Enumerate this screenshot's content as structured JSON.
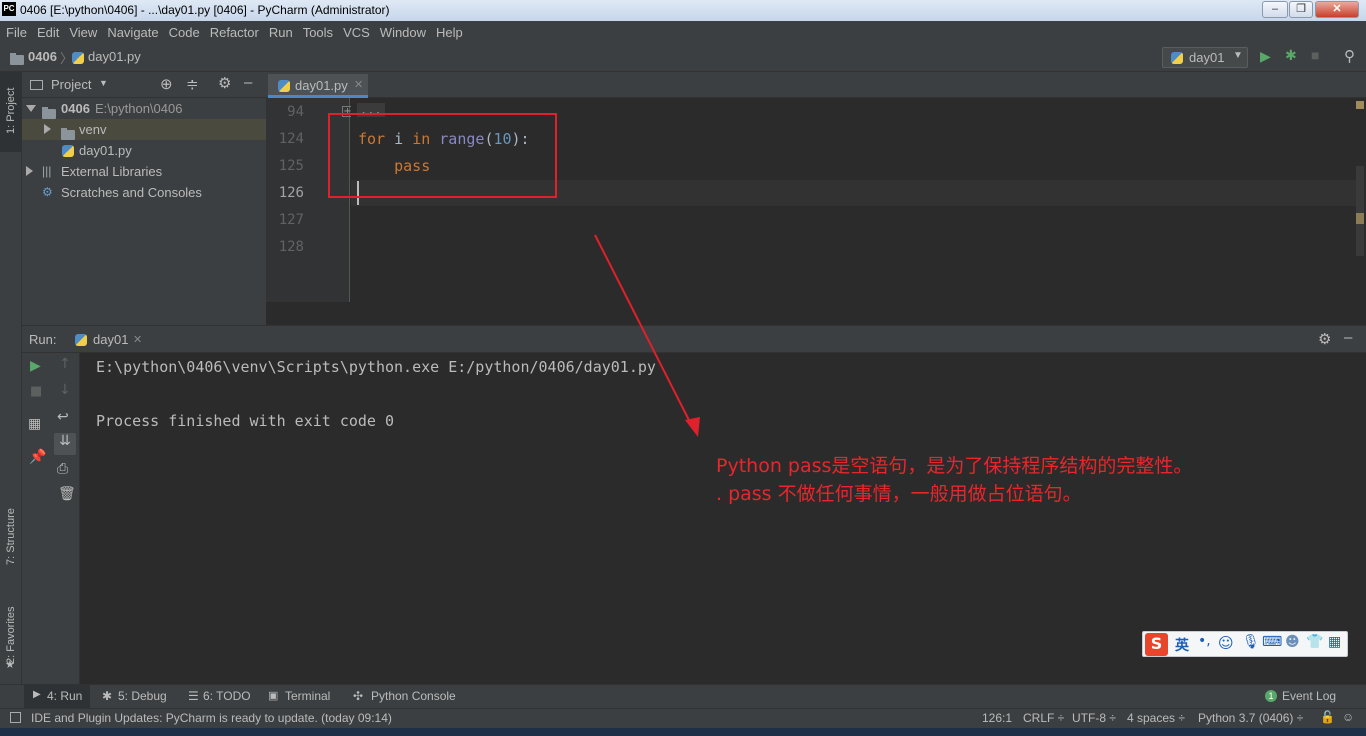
{
  "window": {
    "title": "0406 [E:\\python\\0406] - ...\\day01.py [0406] - PyCharm (Administrator)",
    "logo": "PC"
  },
  "menu": [
    "File",
    "Edit",
    "View",
    "Navigate",
    "Code",
    "Refactor",
    "Run",
    "Tools",
    "VCS",
    "Window",
    "Help"
  ],
  "navbar": {
    "project": "0406",
    "file": "day01.py",
    "run_config": "day01"
  },
  "left_strip": {
    "project": "1: Project",
    "structure": "7: Structure",
    "favorites": "2: Favorites"
  },
  "project_panel": {
    "title": "Project",
    "tree": [
      {
        "label": "0406",
        "path": "E:\\python\\0406"
      },
      {
        "label": "venv"
      },
      {
        "label": "day01.py"
      },
      {
        "label": "External Libraries"
      },
      {
        "label": "Scratches and Consoles"
      }
    ]
  },
  "editor": {
    "tab": "day01.py",
    "line_numbers": [
      "94",
      "124",
      "125",
      "126",
      "127",
      "128"
    ],
    "folded": "...",
    "code": {
      "l124": {
        "kw": "for",
        "var": " i ",
        "in": "in",
        "fn": "range",
        "open": "(",
        "num": "10",
        "close": "):"
      },
      "l125": {
        "indent": "    ",
        "kw": "pass"
      }
    }
  },
  "run_panel": {
    "label": "Run:",
    "tab": "day01",
    "console": [
      "E:\\python\\0406\\venv\\Scripts\\python.exe E:/python/0406/day01.py",
      "",
      "Process finished with exit code 0"
    ]
  },
  "annotation": {
    "line1": "Python pass是空语句，是为了保持程序结构的完整性。",
    "line2": ". pass 不做任何事情，一般用做占位语句。"
  },
  "ime": {
    "label": "英"
  },
  "tool_windows": {
    "run": "4: Run",
    "debug": "5: Debug",
    "todo": "6: TODO",
    "terminal": "Terminal",
    "python_console": "Python Console",
    "event_log": "Event Log",
    "event_count": "1"
  },
  "status": {
    "message": "IDE and Plugin Updates: PyCharm is ready to update. (today 09:14)",
    "position": "126:1",
    "line_sep": "CRLF ÷",
    "encoding": "UTF-8 ÷",
    "indent": "4 spaces ÷",
    "interpreter": "Python 3.7 (0406) ÷"
  },
  "colors": {
    "annotation_red": "#e8262b",
    "keyword": "#cc7832",
    "builtin": "#8888c6",
    "number": "#6897bb",
    "background": "#2b2b2b"
  }
}
